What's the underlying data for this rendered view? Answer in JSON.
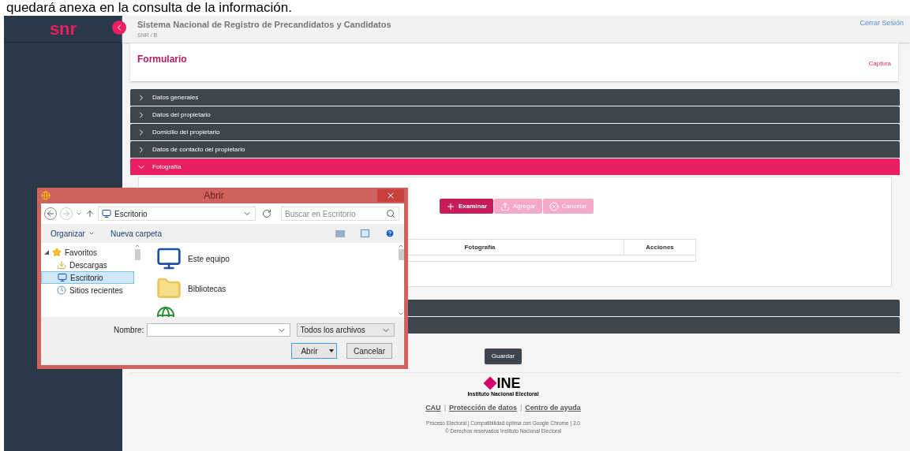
{
  "caption": "quedará anexa en la consulta de la información.",
  "sidebar": {
    "logo_text": "snr"
  },
  "header": {
    "title": "Sistema Nacional de Registro de Precandidatos y Candidatos",
    "subtitle": "SNR / B",
    "logout": "Cerrar Sesión"
  },
  "form": {
    "title": "Formulario",
    "breadcrumb": "Captura"
  },
  "panels": [
    {
      "title": "Datos generales",
      "expanded": false
    },
    {
      "title": "Datos del propietario",
      "expanded": false
    },
    {
      "title": "Domicilio del propietario",
      "expanded": false
    },
    {
      "title": "Datos de contacto del propietario",
      "expanded": false
    },
    {
      "title": "Fotografía",
      "expanded": true
    }
  ],
  "photo": {
    "buttons": [
      {
        "label": "Examinar",
        "kind": "add",
        "disabled": false
      },
      {
        "label": "Agregar",
        "kind": "upload",
        "disabled": true
      },
      {
        "label": "Cancelar",
        "kind": "cancel",
        "disabled": true
      }
    ],
    "columns": [
      "Fotografía",
      "Acciones"
    ]
  },
  "save_button": "Guardar",
  "footer": {
    "logo_text": "INE",
    "logo_subtitle": "Instituto Nacional Electoral",
    "links": [
      "CAU",
      "Protección de datos",
      "Centro de ayuda"
    ],
    "link_separator": "|",
    "lines": [
      "Proceso Electoral | Compatibilidad óptima con Google Chrome | 3.0",
      "© Derechos reservados Instituto Nacional Electoral"
    ]
  },
  "dialog": {
    "title": "Abrir",
    "path": "Escritorio",
    "search_placeholder": "Buscar en Escritorio",
    "toolbar": [
      "Organizar",
      "Nueva carpeta"
    ],
    "tree": [
      {
        "label": "Favoritos",
        "expanded": true,
        "children": [
          {
            "label": "Descargas",
            "selected": false,
            "kind": "downloads"
          },
          {
            "label": "Escritorio",
            "selected": true,
            "kind": "desktop"
          },
          {
            "label": "Sitios recientes",
            "selected": false,
            "kind": "recent"
          }
        ]
      }
    ],
    "files": [
      {
        "label": "Este equipo",
        "kind": "computer"
      },
      {
        "label": "Bibliotecas",
        "kind": "library"
      }
    ],
    "name_label": "Nombre:",
    "filter": "Todos los archivos",
    "open_button": "Abrir",
    "cancel_button": "Cancelar"
  }
}
